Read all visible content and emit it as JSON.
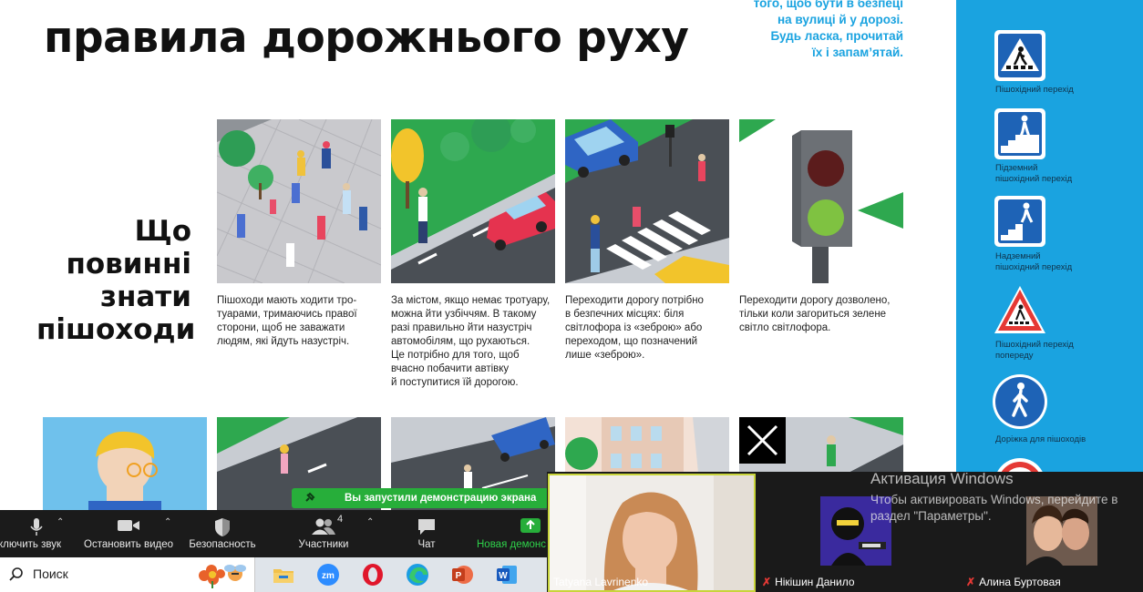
{
  "poster": {
    "title": "правила дорожнього руху",
    "intro_lines": [
      "того, щоб бути в безпеці",
      "на вулиці й у дорозі.",
      "Будь ласка, прочитай",
      "їх і запам’ятай."
    ],
    "section_heading_lines": [
      "Що",
      "повинні",
      "знати",
      "пішоходи"
    ],
    "tiles": [
      {
        "text_lines": [
          "Пішоходи мають ходити тро-",
          "туарами, тримаючись правої",
          "сторони, щоб не заважати",
          "людям, які йдуть назустріч."
        ]
      },
      {
        "text_lines": [
          "За містом, якщо немає тротуару,",
          "можна йти узбіччям. В такому",
          "разі правильно йти назустріч",
          "автомобілям, що рухаються.",
          "Це потрібно для того, щоб",
          "вчасно побачити автівку",
          "й поступитися їй дорогою."
        ]
      },
      {
        "text_lines": [
          "Переходити дорогу потрібно",
          "в безпечних місцях: біля",
          "світлофора із «зеброю» або",
          "переходом, що позначений",
          "лише «зеброю»."
        ]
      },
      {
        "text_lines": [
          "Переходити дорогу дозволено,",
          "тільки коли загориться зелене",
          "світло світлофора."
        ]
      }
    ]
  },
  "sidebar": {
    "signs": [
      {
        "label_lines": [
          "Пішохідний перехід"
        ],
        "icon": "pedestrian-crossing-sign"
      },
      {
        "label_lines": [
          "Підземний",
          "пішохідний перехід"
        ],
        "icon": "underground-crossing-sign"
      },
      {
        "label_lines": [
          "Надземний",
          "пішохідний перехід"
        ],
        "icon": "overhead-crossing-sign"
      },
      {
        "label_lines": [
          "Пішохідний перехід",
          "попереду"
        ],
        "icon": "crossing-ahead-warning-sign"
      },
      {
        "label_lines": [
          "Доріжка для пішоходів"
        ],
        "icon": "pedestrian-path-sign"
      }
    ]
  },
  "zoom": {
    "share_banner": "Вы запустили демонстрацию экрана",
    "controls": {
      "mute_label": "ключить звук",
      "video_label": "Остановить видео",
      "security_label": "Безопасность",
      "participants_label": "Участники",
      "participants_count": "4",
      "chat_label": "Чат",
      "share_label": "Новая демонс"
    },
    "participants": [
      {
        "name": "Tatyana Lavrinenko",
        "muted": false
      },
      {
        "name": "Нікішин Данило",
        "muted": true
      },
      {
        "name": "Алина Буртовая",
        "muted": true
      }
    ]
  },
  "windows": {
    "activation_title": "Активация Windows",
    "activation_line1": "Чтобы активировать Windows, перейдите в",
    "activation_line2": "раздел \"Параметры\".",
    "search_label": "Поиск"
  },
  "colors": {
    "accent_blue": "#1aa3e0",
    "green": "#27ae3a",
    "road": "#4a4f55"
  }
}
